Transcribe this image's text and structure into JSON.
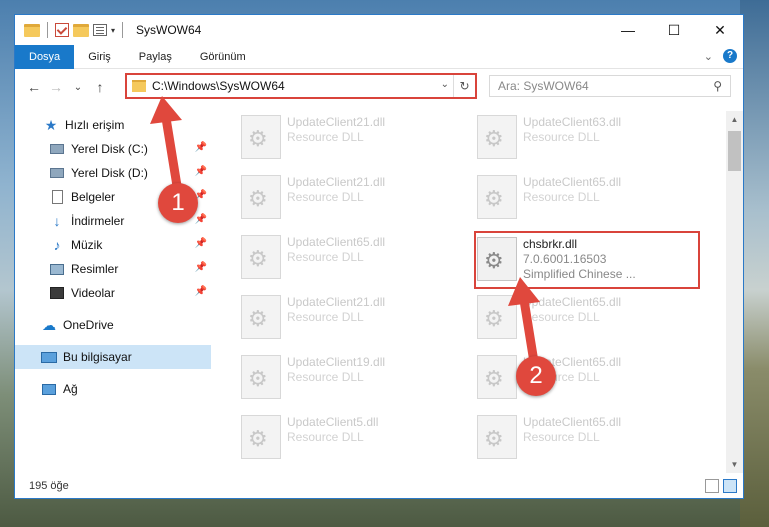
{
  "window": {
    "title": "SysWOW64",
    "controls": {
      "minimize": "—",
      "maximize": "☐",
      "close": "✕"
    }
  },
  "ribbon": {
    "tabs": [
      "Dosya",
      "Giriş",
      "Paylaş",
      "Görünüm"
    ],
    "active_tab": "Dosya",
    "accent_color": "#1979ca"
  },
  "nav": {
    "address": "C:\\Windows\\SysWOW64",
    "search_placeholder": "Ara: SysWOW64",
    "back": "←",
    "forward": "→",
    "recent": "⌄",
    "up": "↑",
    "refresh": "↻",
    "dropdown": "⌄",
    "search_icon": "⚲"
  },
  "sidebar": {
    "items": [
      {
        "label": "Hızlı erişim",
        "icon": "star-icon",
        "pinned": false
      },
      {
        "label": "Yerel Disk (C:)",
        "icon": "drive-icon",
        "pinned": true
      },
      {
        "label": "Yerel Disk (D:)",
        "icon": "drive-icon",
        "pinned": true
      },
      {
        "label": "Belgeler",
        "icon": "documents-icon",
        "pinned": true
      },
      {
        "label": "İndirmeler",
        "icon": "download-icon",
        "pinned": true
      },
      {
        "label": "Müzik",
        "icon": "music-icon",
        "pinned": true
      },
      {
        "label": "Resimler",
        "icon": "pictures-icon",
        "pinned": true
      },
      {
        "label": "Videolar",
        "icon": "videos-icon",
        "pinned": true
      },
      {
        "label": "OneDrive",
        "icon": "cloud-icon",
        "pinned": false
      },
      {
        "label": "Bu bilgisayar",
        "icon": "computer-icon",
        "pinned": false,
        "selected": true
      },
      {
        "label": "Ağ",
        "icon": "network-icon",
        "pinned": false
      }
    ]
  },
  "files": [
    {
      "name": "UpdateClient21.dll",
      "desc": "Resource DLL"
    },
    {
      "name": "UpdateClient63.dll",
      "desc": "Resource DLL"
    },
    {
      "name": "UpdateClient21.dll",
      "desc": "Resource DLL"
    },
    {
      "name": "UpdateClient65.dll",
      "desc": "Resource DLL"
    },
    {
      "name": "UpdateClient65.dll",
      "desc": "Resource DLL"
    },
    {
      "name": "chsbrkr.dll",
      "version": "7.0.6001.16503",
      "desc": "Simplified Chinese ...",
      "highlighted": true
    },
    {
      "name": "UpdateClient21.dll",
      "desc": "Resource DLL"
    },
    {
      "name": "UpdateClient65.dll",
      "desc": "Resource DLL"
    },
    {
      "name": "UpdateClient19.dll",
      "desc": "Resource DLL"
    },
    {
      "name": "UpdateClient65.dll",
      "desc": "Resource DLL"
    },
    {
      "name": "UpdateClient5.dll",
      "desc": "Resource DLL"
    },
    {
      "name": "UpdateClient65.dll",
      "desc": "Resource DLL"
    }
  ],
  "status": {
    "count": "195 öğe"
  },
  "annotations": {
    "step1": "1",
    "step2": "2",
    "color": "#e0483d"
  }
}
